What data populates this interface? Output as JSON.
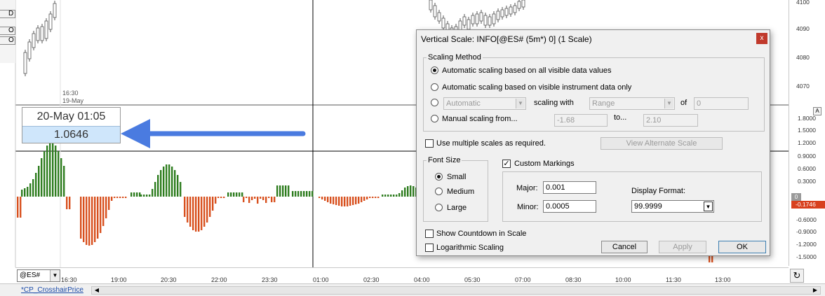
{
  "colors": {
    "accent_blue": "#4a7be0",
    "up_bar": "#2e7d1f",
    "down_bar": "#d8501e",
    "value_flag": "#d8401e"
  },
  "chart": {
    "left_buttons": [
      "D",
      "O",
      "O"
    ],
    "top_labels": [
      "16:30",
      "19-May"
    ],
    "top_price_labels": [
      "4100",
      "4090",
      "4080",
      "4070"
    ],
    "indicator_price_labels": [
      "1.8000",
      "1.5000",
      "1.2000",
      "0.9000",
      "0.6000",
      "0.3000",
      "-0.6000",
      "-0.9000",
      "-1.2000",
      "-1.5000"
    ],
    "zero_marker": "0",
    "value_flag": "-0.1746",
    "axis_button": "A",
    "time_labels": [
      "16:30",
      "19:00",
      "20:30",
      "22:00",
      "23:30",
      "01:00",
      "02:30",
      "04:00",
      "05:30",
      "07:00",
      "08:30",
      "10:00",
      "11:30",
      "13:00"
    ],
    "symbol": "@ES#",
    "tab_name": "*CP_CrosshairPrice",
    "crosshair": {
      "date": "20-May 01:05",
      "value": "1.0646"
    },
    "refresh_icon": "refresh-icon"
  },
  "dialog": {
    "title": "Vertical Scale: INFO[@ES# (5m*) 0] (1 Scale)",
    "close_label": "x",
    "scaling_method": {
      "legend": "Scaling Method",
      "opt_all_visible": "Automatic scaling based on all visible data values",
      "opt_instrument": "Automatic scaling based on visible instrument data only",
      "auto_combo_value": "Automatic",
      "scaling_with_label": "scaling with",
      "range_combo_value": "Range",
      "of_label": "of",
      "of_value": "0",
      "opt_manual": "Manual scaling from...",
      "manual_from": "-1.68",
      "to_label": "to...",
      "manual_to": "2.10"
    },
    "multiple_scales_label": "Use multiple scales as required.",
    "view_alt_scale_label": "View Alternate Scale",
    "font_size": {
      "legend": "Font Size",
      "small": "Small",
      "medium": "Medium",
      "large": "Large"
    },
    "custom_markings": {
      "label": "Custom Markings",
      "major_label": "Major:",
      "major_value": "0.001",
      "minor_label": "Minor:",
      "minor_value": "0.0005",
      "display_format_label": "Display Format:",
      "display_format_value": "99.9999"
    },
    "countdown_label": "Show Countdown in Scale",
    "log_scaling_label": "Logarithmic Scaling",
    "cancel_label": "Cancel",
    "apply_label": "Apply",
    "ok_label": "OK"
  }
}
